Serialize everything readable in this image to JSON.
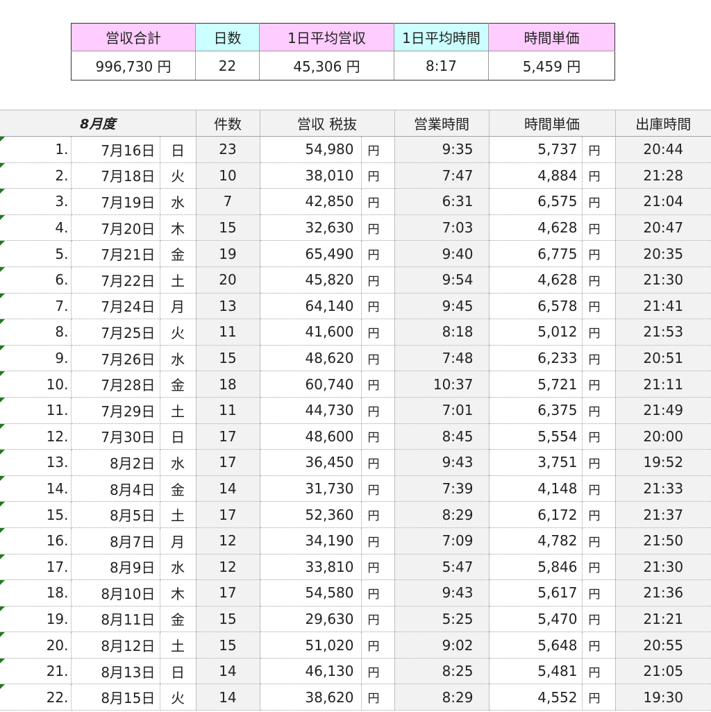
{
  "summary": {
    "headers": [
      "営収合計",
      "日数",
      "1日平均営収",
      "1日平均時間",
      "時間単価"
    ],
    "values": [
      "996,730 円",
      "22",
      "45,306 円",
      "8:17",
      "5,459 円"
    ]
  },
  "main": {
    "headers": {
      "month": "8月度",
      "count": "件数",
      "revenue": "営収 税抜",
      "hours": "営業時間",
      "rate": "時間単価",
      "departure": "出庫時間"
    },
    "yen": "円",
    "rows": [
      {
        "no": "1.",
        "date": "7月16日",
        "dow": "日",
        "count": "23",
        "revenue": "54,980",
        "hours": "9:35",
        "rate": "5,737",
        "out": "20:44"
      },
      {
        "no": "2.",
        "date": "7月18日",
        "dow": "火",
        "count": "10",
        "revenue": "38,010",
        "hours": "7:47",
        "rate": "4,884",
        "out": "21:28"
      },
      {
        "no": "3.",
        "date": "7月19日",
        "dow": "水",
        "count": "7",
        "revenue": "42,850",
        "hours": "6:31",
        "rate": "6,575",
        "out": "21:04"
      },
      {
        "no": "4.",
        "date": "7月20日",
        "dow": "木",
        "count": "15",
        "revenue": "32,630",
        "hours": "7:03",
        "rate": "4,628",
        "out": "20:47"
      },
      {
        "no": "5.",
        "date": "7月21日",
        "dow": "金",
        "count": "19",
        "revenue": "65,490",
        "hours": "9:40",
        "rate": "6,775",
        "out": "20:35"
      },
      {
        "no": "6.",
        "date": "7月22日",
        "dow": "土",
        "count": "20",
        "revenue": "45,820",
        "hours": "9:54",
        "rate": "4,628",
        "out": "21:30"
      },
      {
        "no": "7.",
        "date": "7月24日",
        "dow": "月",
        "count": "13",
        "revenue": "64,140",
        "hours": "9:45",
        "rate": "6,578",
        "out": "21:41"
      },
      {
        "no": "8.",
        "date": "7月25日",
        "dow": "火",
        "count": "11",
        "revenue": "41,600",
        "hours": "8:18",
        "rate": "5,012",
        "out": "21:53"
      },
      {
        "no": "9.",
        "date": "7月26日",
        "dow": "水",
        "count": "15",
        "revenue": "48,620",
        "hours": "7:48",
        "rate": "6,233",
        "out": "20:51"
      },
      {
        "no": "10.",
        "date": "7月28日",
        "dow": "金",
        "count": "18",
        "revenue": "60,740",
        "hours": "10:37",
        "rate": "5,721",
        "out": "21:11"
      },
      {
        "no": "11.",
        "date": "7月29日",
        "dow": "土",
        "count": "11",
        "revenue": "44,730",
        "hours": "7:01",
        "rate": "6,375",
        "out": "21:49"
      },
      {
        "no": "12.",
        "date": "7月30日",
        "dow": "日",
        "count": "17",
        "revenue": "48,600",
        "hours": "8:45",
        "rate": "5,554",
        "out": "20:00"
      },
      {
        "no": "13.",
        "date": "8月2日",
        "dow": "水",
        "count": "17",
        "revenue": "36,450",
        "hours": "9:43",
        "rate": "3,751",
        "out": "19:52"
      },
      {
        "no": "14.",
        "date": "8月4日",
        "dow": "金",
        "count": "14",
        "revenue": "31,730",
        "hours": "7:39",
        "rate": "4,148",
        "out": "21:33"
      },
      {
        "no": "15.",
        "date": "8月5日",
        "dow": "土",
        "count": "17",
        "revenue": "52,360",
        "hours": "8:29",
        "rate": "6,172",
        "out": "21:37"
      },
      {
        "no": "16.",
        "date": "8月7日",
        "dow": "月",
        "count": "12",
        "revenue": "34,190",
        "hours": "7:09",
        "rate": "4,782",
        "out": "21:50"
      },
      {
        "no": "17.",
        "date": "8月9日",
        "dow": "水",
        "count": "12",
        "revenue": "33,810",
        "hours": "5:47",
        "rate": "5,846",
        "out": "21:30"
      },
      {
        "no": "18.",
        "date": "8月10日",
        "dow": "木",
        "count": "17",
        "revenue": "54,580",
        "hours": "9:43",
        "rate": "5,617",
        "out": "21:36"
      },
      {
        "no": "19.",
        "date": "8月11日",
        "dow": "金",
        "count": "15",
        "revenue": "29,630",
        "hours": "5:25",
        "rate": "5,470",
        "out": "21:21"
      },
      {
        "no": "20.",
        "date": "8月12日",
        "dow": "土",
        "count": "15",
        "revenue": "51,020",
        "hours": "9:02",
        "rate": "5,648",
        "out": "20:55"
      },
      {
        "no": "21.",
        "date": "8月13日",
        "dow": "日",
        "count": "14",
        "revenue": "46,130",
        "hours": "8:25",
        "rate": "5,481",
        "out": "21:05"
      },
      {
        "no": "22.",
        "date": "8月15日",
        "dow": "火",
        "count": "14",
        "revenue": "38,620",
        "hours": "8:29",
        "rate": "4,552",
        "out": "19:30"
      }
    ]
  }
}
